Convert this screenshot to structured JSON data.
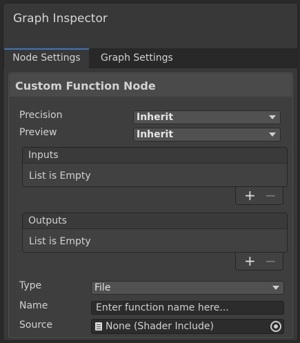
{
  "window": {
    "title": "Graph Inspector"
  },
  "tabs": [
    {
      "label": "Node Settings",
      "active": true
    },
    {
      "label": "Graph Settings",
      "active": false
    }
  ],
  "panel": {
    "title": "Custom Function Node",
    "precision": {
      "label": "Precision",
      "value": "Inherit"
    },
    "preview": {
      "label": "Preview",
      "value": "Inherit"
    },
    "inputs": {
      "header": "Inputs",
      "empty_text": "List is Empty",
      "add_symbol": "+",
      "remove_symbol": "−"
    },
    "outputs": {
      "header": "Outputs",
      "empty_text": "List is Empty",
      "add_symbol": "+",
      "remove_symbol": "−"
    },
    "type": {
      "label": "Type",
      "value": "File"
    },
    "name": {
      "label": "Name",
      "placeholder": "Enter function name here..."
    },
    "source": {
      "label": "Source",
      "value": "None (Shader Include)"
    }
  },
  "colors": {
    "accent": "#3a79bb",
    "window_bg": "#383838",
    "panel_bg": "#3e3e3e"
  },
  "icons": {
    "source_field": "file-icon",
    "source_picker": "object-picker-icon"
  }
}
